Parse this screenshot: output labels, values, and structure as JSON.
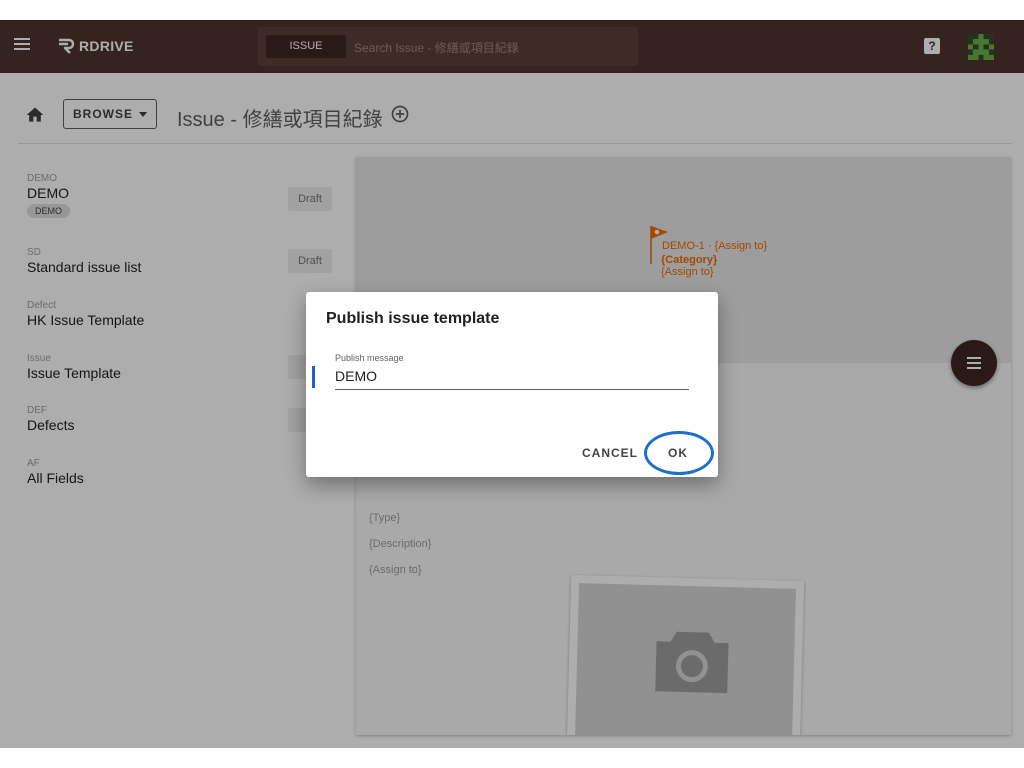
{
  "topbar": {
    "logo_text": "RDRIVE",
    "search_chip": "ISSUE",
    "search_placeholder": "Search Issue - 修繕或項目紀錄",
    "help_glyph": "?"
  },
  "breadcrumb": {
    "browse_label": "BROWSE",
    "title": "Issue - 修繕或項目紀錄"
  },
  "templates": [
    {
      "code": "DEMO",
      "name": "DEMO",
      "chip": "DEMO",
      "status": "Draft"
    },
    {
      "code": "SD",
      "name": "Standard issue list",
      "status": "Draft"
    },
    {
      "code": "Defect",
      "name": "HK Issue Template"
    },
    {
      "code": "Issue",
      "name": "Issue Template",
      "status": "D"
    },
    {
      "code": "DEF",
      "name": "Defects",
      "status": "D"
    },
    {
      "code": "AF",
      "name": "All Fields"
    }
  ],
  "preview": {
    "pin_line1": "DEMO-1 · {Assign to}",
    "pin_line2": "{Category}",
    "pin_line3": "{Assign to}",
    "fields": [
      "{Type}",
      "{Description}",
      "{Assign to}"
    ]
  },
  "dialog": {
    "title": "Publish issue template",
    "field_label": "Publish message",
    "field_value": "DEMO",
    "cancel_label": "CANCEL",
    "ok_label": "OK"
  },
  "colors": {
    "topbar": "#4e342e",
    "accent_orange": "#ef6c00",
    "fab": "#3e2723",
    "focus_ring": "#1e6fc9"
  }
}
